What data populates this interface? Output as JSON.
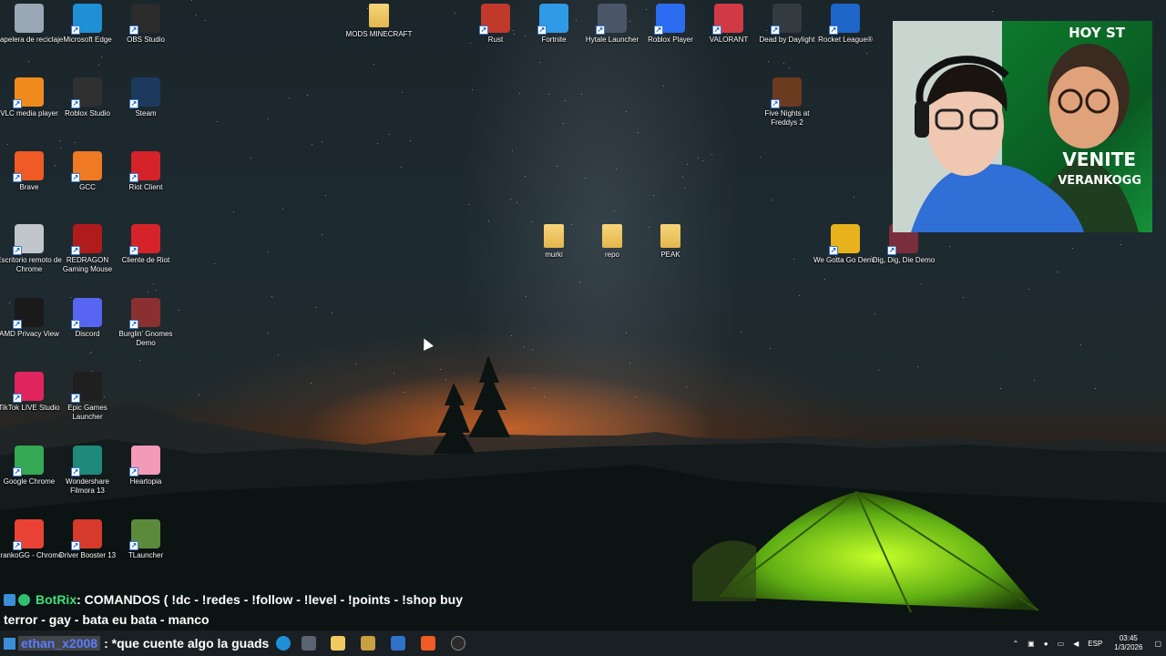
{
  "desktop": {
    "icons": [
      {
        "label": "Papelera de reciclaje",
        "icon": "recycle-bin-icon",
        "color": "#9aa7b4"
      },
      {
        "label": "Microsoft Edge",
        "icon": "edge-icon",
        "color": "#1f8fd6"
      },
      {
        "label": "OBS Studio",
        "icon": "obs-icon",
        "color": "#2b2b2b"
      },
      {
        "label": "MODS MINECRAFT",
        "icon": "folder-icon",
        "color": "#f0c960"
      },
      {
        "label": "Rust",
        "icon": "rust-icon",
        "color": "#c0392b"
      },
      {
        "label": "Fortnite",
        "icon": "fortnite-icon",
        "color": "#2f9be6"
      },
      {
        "label": "Hytale Launcher",
        "icon": "hytale-icon",
        "color": "#4a5568"
      },
      {
        "label": "Roblox Player",
        "icon": "roblox-icon",
        "color": "#2b6cf0"
      },
      {
        "label": "VALORANT",
        "icon": "valorant-icon",
        "color": "#d13a45"
      },
      {
        "label": "Dead by Daylight",
        "icon": "dbd-icon",
        "color": "#333a40"
      },
      {
        "label": "Rocket League®",
        "icon": "rocket-league-icon",
        "color": "#1e66c8"
      },
      {
        "label": "VLC media player",
        "icon": "vlc-icon",
        "color": "#f08a1c"
      },
      {
        "label": "Roblox Studio",
        "icon": "roblox-studio-icon",
        "color": "#303030"
      },
      {
        "label": "Steam",
        "icon": "steam-icon",
        "color": "#1b3a5e"
      },
      {
        "label": "Five Nights at Freddys 2",
        "icon": "fnaf-icon",
        "color": "#6b3a1f"
      },
      {
        "label": "Brave",
        "icon": "brave-icon",
        "color": "#f05a24"
      },
      {
        "label": "GCC",
        "icon": "gcc-icon",
        "color": "#f07a24"
      },
      {
        "label": "Riot Client",
        "icon": "riot-icon",
        "color": "#d6232a"
      },
      {
        "label": "Escritorio remoto de Chrome",
        "icon": "remote-desktop-icon",
        "color": "#c0c6cc"
      },
      {
        "label": "REDRAGON Gaming Mouse",
        "icon": "redragon-icon",
        "color": "#b01c1c"
      },
      {
        "label": "Cliente de Riot",
        "icon": "riot-client-icon",
        "color": "#d6232a"
      },
      {
        "label": "murki",
        "icon": "folder-icon",
        "color": "#f0c960"
      },
      {
        "label": "repo",
        "icon": "folder-icon",
        "color": "#f0c960"
      },
      {
        "label": "PEAK",
        "icon": "folder-icon",
        "color": "#f0c960"
      },
      {
        "label": "We Gotta Go Demo",
        "icon": "we-gotta-go-icon",
        "color": "#e8b21c"
      },
      {
        "label": "Dig, Dig, Die Demo",
        "icon": "dig-dig-die-icon",
        "color": "#7a2d3a"
      },
      {
        "label": "AMD Privacy View",
        "icon": "amd-privacy-icon",
        "color": "#1a1a1a"
      },
      {
        "label": "Discord",
        "icon": "discord-icon",
        "color": "#5865f2"
      },
      {
        "label": "Burglin' Gnomes Demo",
        "icon": "burglin-gnomes-icon",
        "color": "#8a3030"
      },
      {
        "label": "TikTok LIVE Studio",
        "icon": "tiktok-icon",
        "color": "#e0245e"
      },
      {
        "label": "Epic Games Launcher",
        "icon": "epic-games-icon",
        "color": "#1f1f1f"
      },
      {
        "label": "Google Chrome",
        "icon": "chrome-icon",
        "color": "#34a853"
      },
      {
        "label": "Wondershare Filmora 13",
        "icon": "filmora-icon",
        "color": "#1f8a7a"
      },
      {
        "label": "Heartopia",
        "icon": "heartopia-icon",
        "color": "#f39ab8"
      },
      {
        "label": "FrankoGG - Chrome",
        "icon": "chrome-profile-icon",
        "color": "#ea4335"
      },
      {
        "label": "Driver Booster 13",
        "icon": "driver-booster-icon",
        "color": "#d63a2a"
      },
      {
        "label": "TLauncher",
        "icon": "tlauncher-icon",
        "color": "#5a8a3a"
      }
    ]
  },
  "webcam": {
    "hoy": "HOY ST",
    "venite": "VENITE",
    "rankogg": "VERANKOGG"
  },
  "chat": {
    "line1_user": "BotRix",
    "line1_text": ": COMANDOS ( !dc - !redes - !follow - !level - !points - !shop buy",
    "line2_text": "terror - gay - bata eu bata - manco",
    "line3_user": "ethan_x2008",
    "line3_text": ": *que cuente algo la guads"
  },
  "taskbar": {
    "apps": [
      {
        "name": "edge-taskbar-icon",
        "color": "#1f8fd6"
      },
      {
        "name": "task-view-icon",
        "color": "#5a6470"
      },
      {
        "name": "file-explorer-icon",
        "color": "#f0c960"
      },
      {
        "name": "store-icon",
        "color": "#c8a040"
      },
      {
        "name": "mail-icon",
        "color": "#2f72c8"
      },
      {
        "name": "brave-taskbar-icon",
        "color": "#f05a24"
      },
      {
        "name": "obs-taskbar-icon",
        "color": "#2b2b2b"
      }
    ],
    "tray": {
      "language": "ESP",
      "time": "03:45",
      "date": "1/3/2026"
    }
  }
}
